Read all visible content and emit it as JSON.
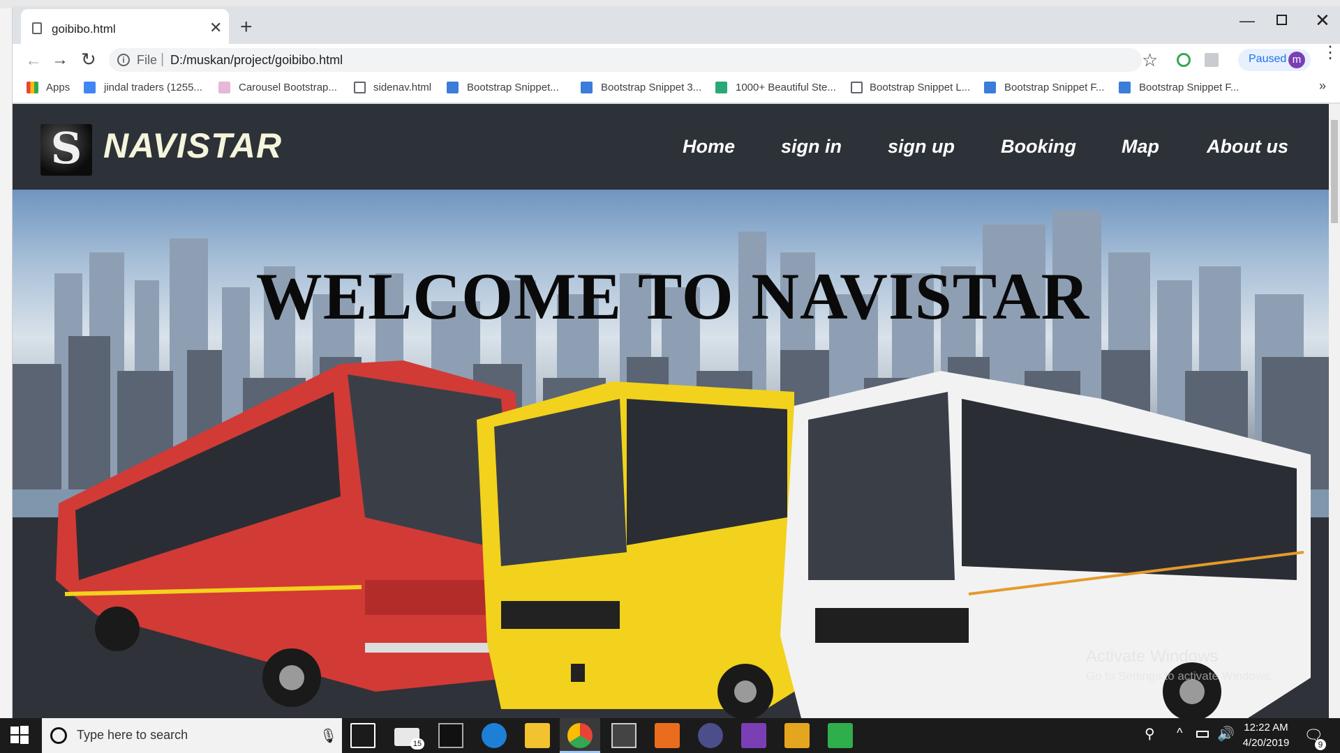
{
  "browser": {
    "tab_title": "goibibo.html",
    "new_tab": "+",
    "url_prefix": "File",
    "url": "D:/muskan/project/goibibo.html",
    "profile_status": "Paused",
    "avatar_initial": "m",
    "bookmarks": [
      {
        "label": "Apps",
        "icon": "apps-grid-icon"
      },
      {
        "label": "jindal traders (1255...",
        "icon": "docs-icon"
      },
      {
        "label": "Carousel Bootstrap...",
        "icon": "bookmark-favicon-icon"
      },
      {
        "label": "sidenav.html",
        "icon": "file-icon"
      },
      {
        "label": "Bootstrap Snippet...",
        "icon": "bootstrap-icon"
      },
      {
        "label": "Bootstrap Snippet 3...",
        "icon": "bootstrap-icon"
      },
      {
        "label": "1000+ Beautiful Ste...",
        "icon": "green-favicon-icon"
      },
      {
        "label": "Bootstrap Snippet L...",
        "icon": "file-icon"
      },
      {
        "label": "Bootstrap Snippet F...",
        "icon": "bootstrap-icon"
      },
      {
        "label": "Bootstrap Snippet F...",
        "icon": "bootstrap-icon"
      }
    ],
    "bookmarks_more": "»"
  },
  "site": {
    "brand": "NAVISTAR",
    "nav": [
      "Home",
      "sign in",
      "sign up",
      "Booking",
      "Map",
      "About us"
    ],
    "hero_title": "WELCOME TO NAVISTAR",
    "watermark_line1": "Activate Windows",
    "watermark_line2": "Go to Settings to activate Windows."
  },
  "taskbar": {
    "search_placeholder": "Type here to search",
    "mail_badge": "15",
    "time": "12:22 AM",
    "date": "4/20/2019",
    "notifications": "9"
  },
  "colors": {
    "navbar": "#2d3238",
    "brand_text": "#f5f5dc",
    "hero_text": "#0a0a0a",
    "bus_red": "#d23a36",
    "bus_yellow": "#f2d21c",
    "bus_white": "#f2f2f2"
  }
}
